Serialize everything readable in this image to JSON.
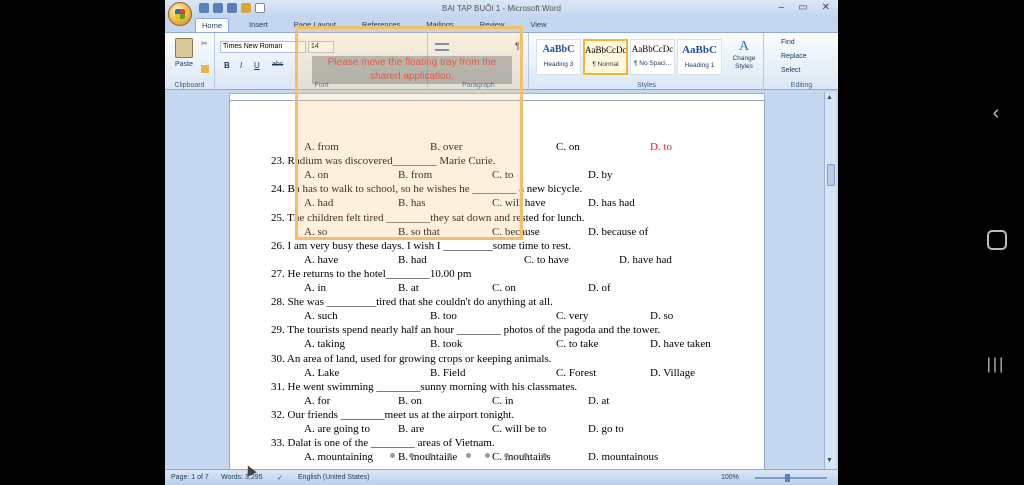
{
  "window": {
    "title": "BAI TAP BUỔI 1 - Microsoft Word",
    "controls": [
      "–",
      "▭",
      "✕"
    ]
  },
  "tabs": [
    "Home",
    "Insert",
    "Page Layout",
    "References",
    "Mailings",
    "Review",
    "View"
  ],
  "ribbon": {
    "clipboard": {
      "paste": "Paste",
      "label": "Clipboard"
    },
    "font": {
      "name": "Times New Roman",
      "size": "14",
      "label": "Font",
      "bold": "B",
      "italic": "I",
      "underline": "U",
      "strike": "abc"
    },
    "paragraph": {
      "label": "Paragraph"
    },
    "styles": {
      "label": "Styles",
      "items": [
        {
          "preview": "AaBbC",
          "name": "Heading 3"
        },
        {
          "preview": "AaBbCcDc",
          "name": "¶ Normal"
        },
        {
          "preview": "AaBbCcDc",
          "name": "¶ No Spaci..."
        },
        {
          "preview": "AaBbC",
          "name": "Heading 1"
        }
      ],
      "change": "Change Styles"
    },
    "editing": {
      "find": "Find",
      "replace": "Replace",
      "select": "Select",
      "label": "Editing"
    }
  },
  "overlay_message": "Please move the floating tray from the shared application.",
  "document": {
    "lines": [
      {
        "kind": "opts",
        "opts": [
          "A. from",
          "B. over",
          "C. on",
          "D. to"
        ],
        "red": 3,
        "layout": "wide"
      },
      {
        "kind": "q",
        "text": "23. Radium was discovered________ Marie Curie."
      },
      {
        "kind": "opts",
        "opts": [
          "A. on",
          "B. from",
          "C. to",
          "D. by"
        ],
        "layout": "narrow"
      },
      {
        "kind": "q",
        "text": "24. Ba has to walk to school, so he wishes he ________ a new bicycle."
      },
      {
        "kind": "opts",
        "opts": [
          "A. had",
          "B. has",
          "C. will have",
          "D. has had"
        ],
        "layout": "narrow"
      },
      {
        "kind": "q",
        "text": "25. The children felt tired ________they sat down and rested for lunch."
      },
      {
        "kind": "opts",
        "opts": [
          "A. so",
          "B. so that",
          "C. because",
          "D. because of"
        ],
        "layout": "narrow"
      },
      {
        "kind": "q",
        "text": "26. I am very busy these days. I wish I _________some time to rest."
      },
      {
        "kind": "opts",
        "opts": [
          "A. have",
          "B. had",
          "C. to have",
          "D. have had"
        ],
        "layout": "narrow2"
      },
      {
        "kind": "q",
        "text": "27. He returns to the hotel________10.00 pm"
      },
      {
        "kind": "opts",
        "opts": [
          "A. in",
          "B. at",
          "C. on",
          "D. of"
        ],
        "layout": "narrow"
      },
      {
        "kind": "q",
        "text": "28. She was _________tired that she couldn't do anything at all."
      },
      {
        "kind": "opts",
        "opts": [
          "A. such",
          "B. too",
          "C. very",
          "D. so"
        ],
        "layout": "wide"
      },
      {
        "kind": "q",
        "text": "29. The tourists spend nearly half an hour ________ photos of the pagoda and the tower."
      },
      {
        "kind": "opts",
        "opts": [
          "A. taking",
          "B. took",
          "C. to take",
          "D. have taken"
        ],
        "layout": "wide"
      },
      {
        "kind": "q",
        "text": "30. An area of land, used for growing crops or keeping animals."
      },
      {
        "kind": "opts",
        "opts": [
          "A. Lake",
          "B. Field",
          "C. Forest",
          "D. Village"
        ],
        "layout": "wide"
      },
      {
        "kind": "q",
        "text": "31. He went swimming ________sunny morning with his classmates."
      },
      {
        "kind": "opts",
        "opts": [
          "A. for",
          "B. on",
          "C. in",
          "D. at"
        ],
        "layout": "narrow"
      },
      {
        "kind": "q",
        "text": "32. Our friends ________meet us at the airport tonight."
      },
      {
        "kind": "opts",
        "opts": [
          "A. are going to",
          "B. are",
          "C. will be to",
          "D. go to"
        ],
        "layout": "narrow"
      },
      {
        "kind": "q",
        "text": "33. Dalat is one of the ________ areas of Vietnam."
      },
      {
        "kind": "opts",
        "opts": [
          "A. mountaining",
          "B. mountaine",
          "C. mountains",
          "D. mountainous"
        ],
        "layout": "narrow"
      }
    ]
  },
  "status": {
    "page": "Page: 1 of 7",
    "words": "Words: 3,295",
    "language": "English (United States)",
    "zoom": "100%"
  },
  "nav": {
    "back": "‹",
    "recents": "|||"
  }
}
